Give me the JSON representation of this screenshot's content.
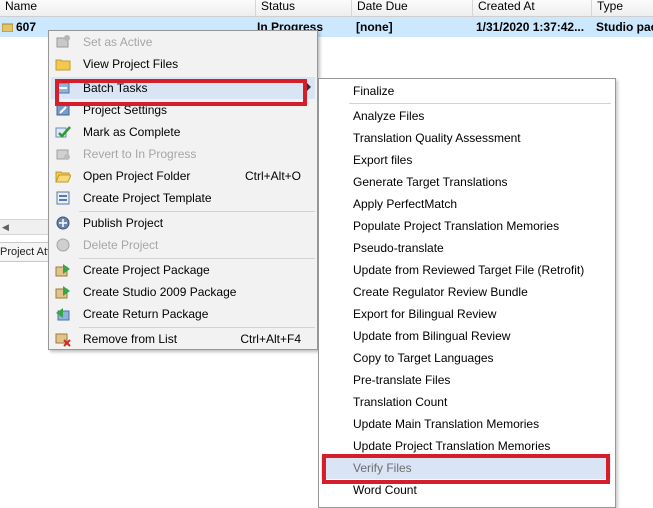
{
  "table": {
    "headers": [
      "Name",
      "Status",
      "Date Due",
      "Created At",
      "Type"
    ],
    "row": {
      "name": "607",
      "status": "In Progress",
      "date_due": "[none]",
      "created_at": "1/31/2020 1:37:42...",
      "type": "Studio pac"
    }
  },
  "lower_panel": {
    "tab_label": "Project Attri"
  },
  "context_menu": {
    "items": [
      {
        "label": "Set as Active",
        "shortcut": "",
        "icon": "set-active-icon",
        "enabled": false
      },
      {
        "label": "View Project Files",
        "shortcut": "",
        "icon": "folder-icon",
        "enabled": true
      },
      {
        "label": "Batch Tasks",
        "shortcut": "",
        "icon": "batch-tasks-icon",
        "enabled": true,
        "submenu": true
      },
      {
        "label": "Project Settings",
        "shortcut": "",
        "icon": "settings-icon",
        "enabled": true
      },
      {
        "label": "Mark as Complete",
        "shortcut": "",
        "icon": "checkmark-icon",
        "enabled": true
      },
      {
        "label": "Revert to In Progress",
        "shortcut": "",
        "icon": "revert-icon",
        "enabled": false
      },
      {
        "label": "Open Project Folder",
        "shortcut": "Ctrl+Alt+O",
        "icon": "open-folder-icon",
        "enabled": true
      },
      {
        "label": "Create Project Template",
        "shortcut": "",
        "icon": "template-icon",
        "enabled": true
      },
      {
        "label": "Publish Project",
        "shortcut": "",
        "icon": "publish-icon",
        "enabled": true
      },
      {
        "label": "Delete Project",
        "shortcut": "",
        "icon": "delete-project-icon",
        "enabled": false
      },
      {
        "label": "Create Project Package",
        "shortcut": "",
        "icon": "package-icon",
        "enabled": true
      },
      {
        "label": "Create Studio 2009 Package",
        "shortcut": "",
        "icon": "studio-package-icon",
        "enabled": true
      },
      {
        "label": "Create Return Package",
        "shortcut": "",
        "icon": "return-package-icon",
        "enabled": true
      },
      {
        "label": "Remove from List",
        "shortcut": "Ctrl+Alt+F4",
        "icon": "remove-icon",
        "enabled": true
      }
    ]
  },
  "batch_submenu": {
    "items": [
      "Finalize",
      "Analyze Files",
      "Translation Quality Assessment",
      "Export files",
      "Generate Target Translations",
      "Apply PerfectMatch",
      "Populate Project Translation Memories",
      "Pseudo-translate",
      "Update from Reviewed Target File (Retrofit)",
      "Create Regulator Review Bundle",
      "Export for Bilingual Review",
      "Update from Bilingual Review",
      "Copy to Target Languages",
      "Pre-translate Files",
      "Translation Count",
      "Update Main Translation Memories",
      "Update Project Translation Memories",
      "Verify Files",
      "Word Count"
    ]
  },
  "colors": {
    "selection_row": "#cce8ff",
    "menu_highlight": "#d9e5f5",
    "annotation_red": "#d41f2a"
  }
}
